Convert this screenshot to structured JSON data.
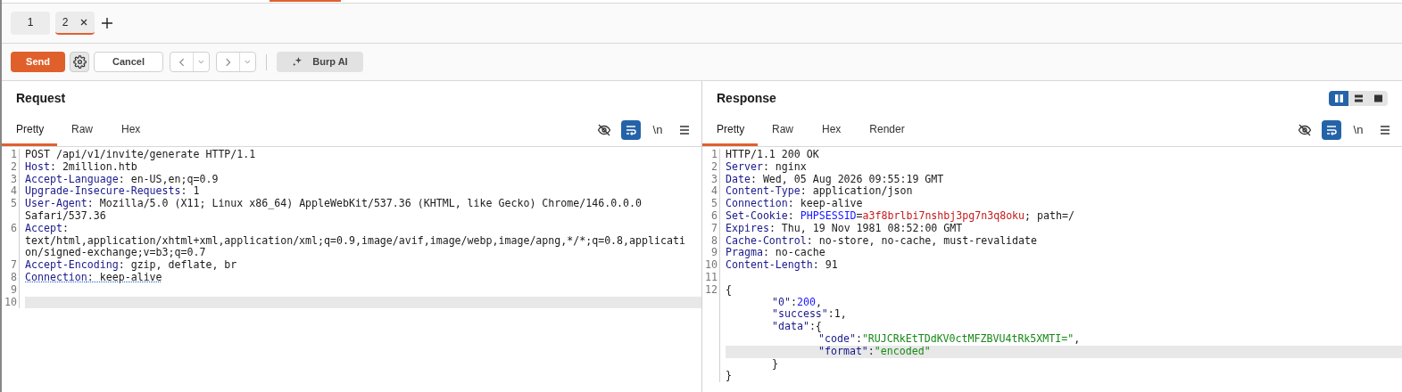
{
  "repeater_tabs": [
    {
      "label": "1",
      "selected": false,
      "closable": false
    },
    {
      "label": "2",
      "selected": true,
      "closable": true
    }
  ],
  "toolbar": {
    "send": "Send",
    "cancel": "Cancel",
    "ai": "Burp AI"
  },
  "panels": [
    {
      "title": "Request",
      "tabs": [
        {
          "label": "Pretty",
          "selected": true
        },
        {
          "label": "Raw",
          "selected": false
        },
        {
          "label": "Hex",
          "selected": false
        }
      ],
      "tools": [
        {
          "kind": "hide",
          "selected": false
        },
        {
          "kind": "wrap",
          "selected": true
        },
        {
          "kind": "newline",
          "label": "\\n",
          "selected": false
        },
        {
          "kind": "menu",
          "selected": false
        }
      ],
      "lines": [
        {
          "n": "1",
          "segments": [
            {
              "kind": "flush",
              "current": false,
              "tokens": [
                {
                  "kind": "plain",
                  "text": "POST /api/v1/invite/generate HTTP/1.1"
                }
              ]
            }
          ]
        },
        {
          "n": "2",
          "segments": [
            {
              "kind": "flush",
              "current": false,
              "tokens": [
                {
                  "kind": "key",
                  "text": "Host"
                },
                {
                  "kind": "plain",
                  "text": ": 2million.htb"
                }
              ]
            }
          ]
        },
        {
          "n": "3",
          "segments": [
            {
              "kind": "flush",
              "current": false,
              "tokens": [
                {
                  "kind": "key",
                  "text": "Accept-Language"
                },
                {
                  "kind": "plain",
                  "text": ": en-US,en;q=0.9"
                }
              ]
            }
          ]
        },
        {
          "n": "4",
          "segments": [
            {
              "kind": "flush",
              "current": false,
              "tokens": [
                {
                  "kind": "key",
                  "text": "Upgrade-Insecure-Requests"
                },
                {
                  "kind": "plain",
                  "text": ": 1"
                }
              ]
            }
          ]
        },
        {
          "n": "5",
          "segments": [
            {
              "kind": "flush",
              "current": false,
              "tokens": [
                {
                  "kind": "key",
                  "text": "User-Agent"
                },
                {
                  "kind": "plain",
                  "text": ": Mozilla/5.0 (X11; Linux x86_64) AppleWebKit/537.36 (KHTML, like Gecko) Chrome/146.0.0.0"
                }
              ]
            },
            {
              "kind": "flush",
              "current": false,
              "tokens": [
                {
                  "kind": "plain",
                  "text": "Safari/537.36"
                }
              ]
            }
          ]
        },
        {
          "n": "6",
          "segments": [
            {
              "kind": "flush",
              "current": false,
              "tokens": [
                {
                  "kind": "key",
                  "text": "Accept"
                },
                {
                  "kind": "plain",
                  "text": ":"
                }
              ]
            },
            {
              "kind": "flush",
              "current": false,
              "tokens": [
                {
                  "kind": "plain",
                  "text": "text/html,application/xhtml+xml,application/xml;q=0.9,image/avif,image/webp,image/apng,*/*;q=0.8,applicati"
                }
              ]
            },
            {
              "kind": "flush",
              "current": false,
              "tokens": [
                {
                  "kind": "plain",
                  "text": "on/signed-exchange;v=b3;q=0.7"
                }
              ]
            }
          ]
        },
        {
          "n": "7",
          "segments": [
            {
              "kind": "flush",
              "current": false,
              "tokens": [
                {
                  "kind": "key",
                  "text": "Accept-Encoding"
                },
                {
                  "kind": "plain",
                  "text": ": gzip, deflate, br"
                }
              ]
            }
          ]
        },
        {
          "n": "8",
          "underlined": true,
          "segments": [
            {
              "kind": "flush",
              "current": false,
              "tokens": [
                {
                  "kind": "key",
                  "text": "Connection"
                },
                {
                  "kind": "plain",
                  "text": ": keep-alive"
                }
              ]
            }
          ]
        },
        {
          "n": "9",
          "segments": [
            {
              "kind": "flush",
              "current": false
            }
          ]
        },
        {
          "n": "10",
          "segments": [
            {
              "kind": "flush",
              "current": true
            }
          ]
        }
      ]
    },
    {
      "title": "Response",
      "layout_modes": [
        {
          "kind": "split",
          "selected": true
        },
        {
          "kind": "stacked",
          "selected": false
        },
        {
          "kind": "single",
          "selected": false
        }
      ],
      "tabs": [
        {
          "label": "Pretty",
          "selected": true
        },
        {
          "label": "Raw",
          "selected": false
        },
        {
          "label": "Hex",
          "selected": false
        },
        {
          "label": "Render",
          "selected": false
        }
      ],
      "tools": [
        {
          "kind": "hide",
          "selected": false
        },
        {
          "kind": "wrap",
          "selected": true
        },
        {
          "kind": "newline",
          "label": "\\n",
          "selected": false
        },
        {
          "kind": "menu",
          "selected": false
        }
      ],
      "lines": [
        {
          "n": "1",
          "segments": [
            {
              "kind": "flush",
              "current": false,
              "tokens": [
                {
                  "kind": "plain",
                  "text": "HTTP/1.1 200 OK"
                }
              ]
            }
          ]
        },
        {
          "n": "2",
          "segments": [
            {
              "kind": "flush",
              "current": false,
              "tokens": [
                {
                  "kind": "key",
                  "text": "Server"
                },
                {
                  "kind": "plain",
                  "text": ": nginx"
                }
              ]
            }
          ]
        },
        {
          "n": "3",
          "segments": [
            {
              "kind": "flush",
              "current": false,
              "tokens": [
                {
                  "kind": "key",
                  "text": "Date"
                },
                {
                  "kind": "plain",
                  "text": ": Wed, 05 Aug 2026 09:55:19 GMT"
                }
              ]
            }
          ]
        },
        {
          "n": "4",
          "segments": [
            {
              "kind": "flush",
              "current": false,
              "tokens": [
                {
                  "kind": "key",
                  "text": "Content-Type"
                },
                {
                  "kind": "plain",
                  "text": ": application/json"
                }
              ]
            }
          ]
        },
        {
          "n": "5",
          "segments": [
            {
              "kind": "flush",
              "current": false,
              "tokens": [
                {
                  "kind": "key",
                  "text": "Connection"
                },
                {
                  "kind": "plain",
                  "text": ": keep-alive"
                }
              ]
            }
          ]
        },
        {
          "n": "6",
          "segments": [
            {
              "kind": "flush",
              "current": false,
              "tokens": [
                {
                  "kind": "key",
                  "text": "Set-Cookie"
                },
                {
                  "kind": "plain",
                  "text": ": "
                },
                {
                  "kind": "param",
                  "text": "PHPSESSID"
                },
                {
                  "kind": "plain",
                  "text": "="
                },
                {
                  "kind": "cookie",
                  "text": "a3f8brlbi7nshbj3pg7n3q8oku"
                },
                {
                  "kind": "plain",
                  "text": "; path=/"
                }
              ]
            }
          ]
        },
        {
          "n": "7",
          "segments": [
            {
              "kind": "flush",
              "current": false,
              "tokens": [
                {
                  "kind": "key",
                  "text": "Expires"
                },
                {
                  "kind": "plain",
                  "text": ": Thu, 19 Nov 1981 08:52:00 GMT"
                }
              ]
            }
          ]
        },
        {
          "n": "8",
          "segments": [
            {
              "kind": "flush",
              "current": false,
              "tokens": [
                {
                  "kind": "key",
                  "text": "Cache-Control"
                },
                {
                  "kind": "plain",
                  "text": ": no-store, no-cache, must-revalidate"
                }
              ]
            }
          ]
        },
        {
          "n": "9",
          "segments": [
            {
              "kind": "flush",
              "current": false,
              "tokens": [
                {
                  "kind": "key",
                  "text": "Pragma"
                },
                {
                  "kind": "plain",
                  "text": ": no-cache"
                }
              ]
            }
          ]
        },
        {
          "n": "10",
          "segments": [
            {
              "kind": "flush",
              "current": false,
              "tokens": [
                {
                  "kind": "key",
                  "text": "Content-Length"
                },
                {
                  "kind": "plain",
                  "text": ": 91"
                }
              ]
            }
          ]
        },
        {
          "n": "11",
          "segments": [
            {
              "kind": "flush",
              "current": false
            }
          ]
        },
        {
          "n": "12",
          "segments": [
            {
              "kind": "flush",
              "current": false,
              "tokens": [
                {
                  "kind": "plain",
                  "text": "{"
                }
              ]
            },
            {
              "kind": "inner",
              "current": false,
              "tokens": [
                {
                  "kind": "jkey",
                  "text": "\"0\""
                },
                {
                  "kind": "plain",
                  "text": ":"
                },
                {
                  "kind": "number",
                  "text": "200"
                },
                {
                  "kind": "plain",
                  "text": ","
                }
              ]
            },
            {
              "kind": "inner",
              "current": false,
              "tokens": [
                {
                  "kind": "jkey",
                  "text": "\"success\""
                },
                {
                  "kind": "plain",
                  "text": ":1,"
                }
              ]
            },
            {
              "kind": "inner",
              "current": false,
              "tokens": [
                {
                  "kind": "jkey",
                  "text": "\"data\""
                },
                {
                  "kind": "plain",
                  "text": ":{"
                }
              ]
            },
            {
              "kind": "deep",
              "current": false,
              "tokens": [
                {
                  "kind": "jkey",
                  "text": "\"code\""
                },
                {
                  "kind": "plain",
                  "text": ":"
                },
                {
                  "kind": "string",
                  "text": "\"RUJCRkEtTDdKV0ctMFZBVU4tRk5XMTI=\""
                },
                {
                  "kind": "plain",
                  "text": ","
                }
              ]
            },
            {
              "kind": "deep",
              "current": true,
              "tokens": [
                {
                  "kind": "jkey",
                  "text": "\"format\""
                },
                {
                  "kind": "plain",
                  "text": ":"
                },
                {
                  "kind": "string",
                  "text": "\"encoded\""
                }
              ]
            },
            {
              "kind": "inner",
              "current": false,
              "tokens": [
                {
                  "kind": "plain",
                  "text": "}"
                }
              ]
            },
            {
              "kind": "flush",
              "current": false,
              "tokens": [
                {
                  "kind": "plain",
                  "text": "}"
                }
              ]
            }
          ]
        }
      ]
    }
  ]
}
